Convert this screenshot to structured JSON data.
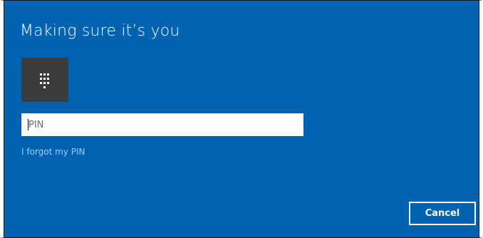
{
  "dialog": {
    "title": "Making sure it’s you",
    "icon": "pin-keypad-icon",
    "pin_field": {
      "placeholder": "PIN",
      "value": ""
    },
    "forgot_link_label": "I forgot my PIN",
    "cancel_label": "Cancel"
  },
  "colors": {
    "background": "#0063b1",
    "tile": "#3b3b3b",
    "link": "#9ecbff",
    "text": "#ffffff"
  }
}
